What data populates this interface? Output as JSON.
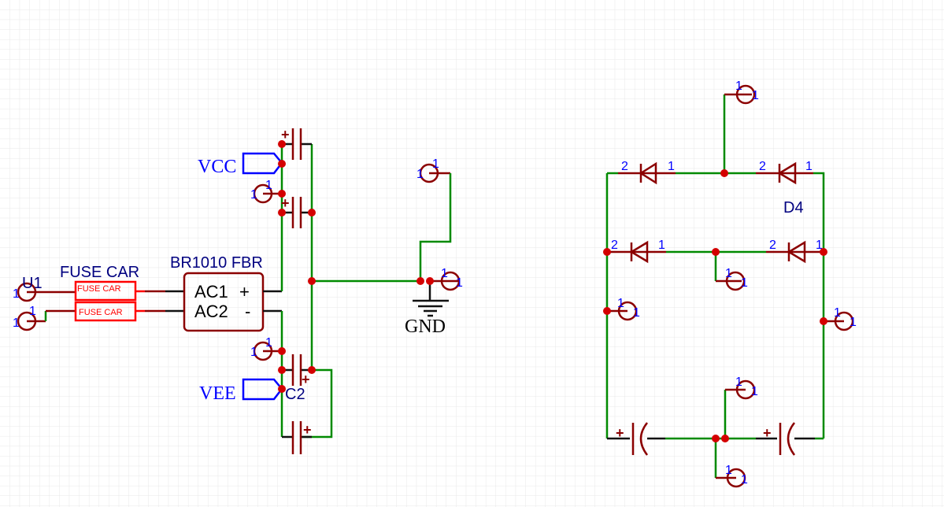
{
  "canvas": {
    "grid": true,
    "background": "#ffffff",
    "grid_color": "#e8e8e8"
  },
  "colors": {
    "wire": "#008a00",
    "symbol": "#8b0000",
    "junction": "#d40000",
    "net_label": "#0000ff",
    "designator": "#000080",
    "fuse": "#ff0000"
  },
  "pin_label": "1",
  "connector": {
    "designator": "U1"
  },
  "fuse": {
    "designator": "FUSE CAR",
    "value": "FUSE CAR"
  },
  "bridge": {
    "designator": "BR1010 FBR",
    "pin_ac1": "AC1",
    "pin_ac2": "AC2",
    "pin_plus": "+",
    "pin_minus": "-"
  },
  "capacitor": {
    "designator": "C2",
    "polarity": "+"
  },
  "net_labels": {
    "vcc": "VCC",
    "vee": "VEE",
    "gnd": "GND"
  },
  "diode": {
    "designator": "D4",
    "pin_anode": "2",
    "pin_cathode": "1"
  }
}
